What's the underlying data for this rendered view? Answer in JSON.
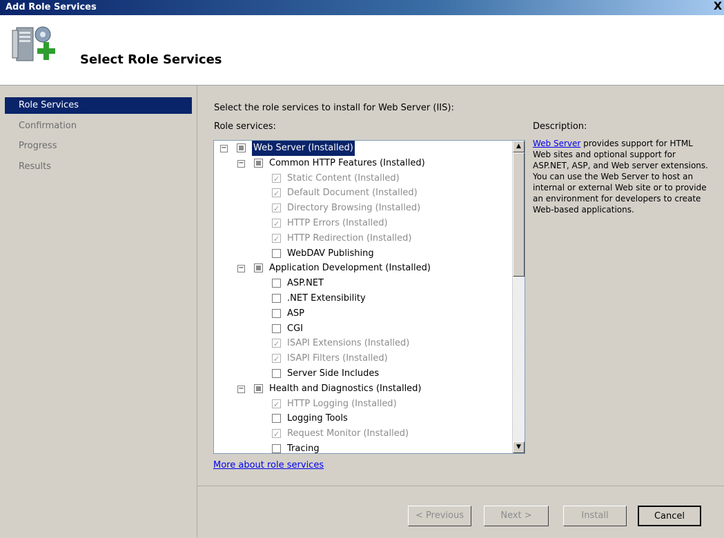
{
  "window": {
    "title": "Add Role Services",
    "close_glyph": "X"
  },
  "header": {
    "title": "Select Role Services",
    "icon": "server-add-icon"
  },
  "nav": {
    "items": [
      {
        "label": "Role Services",
        "active": true
      },
      {
        "label": "Confirmation",
        "active": false
      },
      {
        "label": "Progress",
        "active": false
      },
      {
        "label": "Results",
        "active": false
      }
    ]
  },
  "main": {
    "instruction": "Select the role services to install for Web Server (IIS):",
    "role_services_label": "Role services:",
    "description_label": "Description:",
    "description_link": "Web Server",
    "description_text": " provides support for HTML Web sites and optional support for ASP.NET, ASP, and Web server extensions. You can use the Web Server to host an internal or external Web site or to provide an environment for developers to create Web-based applications.",
    "more_link": "More about role services"
  },
  "tree": {
    "items": [
      {
        "label": "Web Server  (Installed)",
        "level": 0,
        "expander": "−",
        "state": "partial",
        "selected": true,
        "dim": false
      },
      {
        "label": "Common HTTP Features  (Installed)",
        "level": 1,
        "expander": "−",
        "state": "partial",
        "selected": false,
        "dim": false
      },
      {
        "label": "Static Content  (Installed)",
        "level": 2,
        "state": "checked",
        "dim": true
      },
      {
        "label": "Default Document  (Installed)",
        "level": 2,
        "state": "checked",
        "dim": true
      },
      {
        "label": "Directory Browsing  (Installed)",
        "level": 2,
        "state": "checked",
        "dim": true
      },
      {
        "label": "HTTP Errors  (Installed)",
        "level": 2,
        "state": "checked",
        "dim": true
      },
      {
        "label": "HTTP Redirection  (Installed)",
        "level": 2,
        "state": "checked",
        "dim": true
      },
      {
        "label": "WebDAV Publishing",
        "level": 2,
        "state": "unchecked",
        "dim": false
      },
      {
        "label": "Application Development  (Installed)",
        "level": 1,
        "expander": "−",
        "state": "partial",
        "selected": false,
        "dim": false
      },
      {
        "label": "ASP.NET",
        "level": 2,
        "state": "unchecked",
        "dim": false
      },
      {
        "label": ".NET Extensibility",
        "level": 2,
        "state": "unchecked",
        "dim": false
      },
      {
        "label": "ASP",
        "level": 2,
        "state": "unchecked",
        "dim": false
      },
      {
        "label": "CGI",
        "level": 2,
        "state": "unchecked",
        "dim": false
      },
      {
        "label": "ISAPI Extensions  (Installed)",
        "level": 2,
        "state": "checked",
        "dim": true
      },
      {
        "label": "ISAPI Filters  (Installed)",
        "level": 2,
        "state": "checked",
        "dim": true
      },
      {
        "label": "Server Side Includes",
        "level": 2,
        "state": "unchecked",
        "dim": false
      },
      {
        "label": "Health and Diagnostics  (Installed)",
        "level": 1,
        "expander": "−",
        "state": "partial",
        "selected": false,
        "dim": false
      },
      {
        "label": "HTTP Logging  (Installed)",
        "level": 2,
        "state": "checked",
        "dim": true
      },
      {
        "label": "Logging Tools",
        "level": 2,
        "state": "unchecked",
        "dim": false
      },
      {
        "label": "Request Monitor  (Installed)",
        "level": 2,
        "state": "checked",
        "dim": true
      },
      {
        "label": "Tracing",
        "level": 2,
        "state": "unchecked",
        "dim": false
      }
    ]
  },
  "scrollbar": {
    "up_glyph": "▲",
    "down_glyph": "▼"
  },
  "buttons": {
    "previous": "< Previous",
    "next": "Next >",
    "install": "Install",
    "cancel": "Cancel"
  }
}
